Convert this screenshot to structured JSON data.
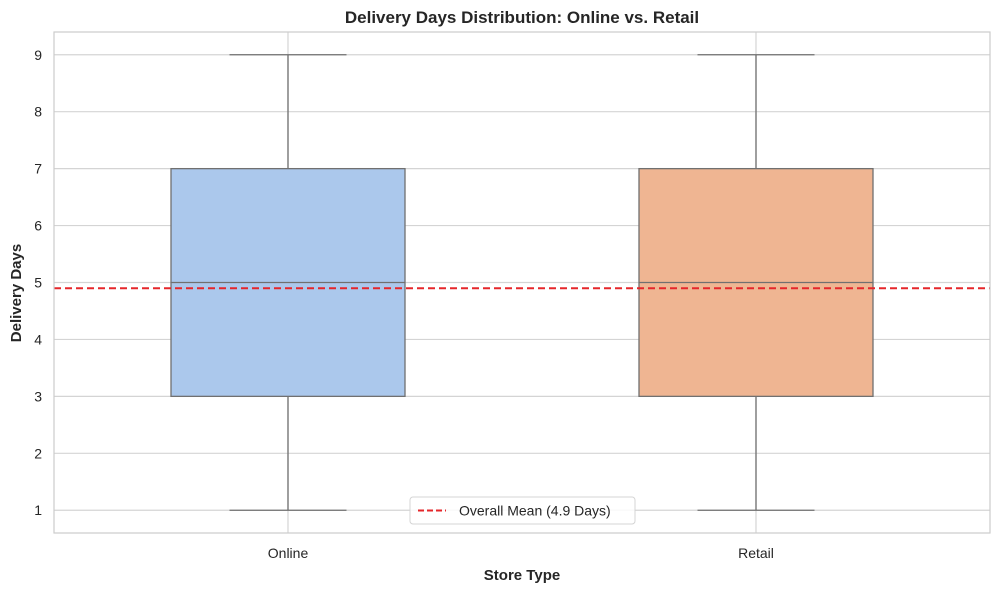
{
  "chart_data": {
    "type": "box",
    "title": "Delivery Days Distribution: Online vs. Retail",
    "xlabel": "Store Type",
    "ylabel": "Delivery Days",
    "ylim": [
      0.6,
      9.4
    ],
    "yticks": [
      1,
      2,
      3,
      4,
      5,
      6,
      7,
      8,
      9
    ],
    "categories": [
      "Online",
      "Retail"
    ],
    "boxes": [
      {
        "category": "Online",
        "min": 1,
        "q1": 3,
        "median": 5,
        "q3": 7,
        "max": 9,
        "color": "#abc8ec"
      },
      {
        "category": "Retail",
        "min": 1,
        "q1": 3,
        "median": 5,
        "q3": 7,
        "max": 9,
        "color": "#efb592"
      }
    ],
    "reference_line": {
      "value": 4.9,
      "label": "Overall Mean (4.9 Days)",
      "color": "#e5262a",
      "style": "dashed"
    },
    "grid": true,
    "legend_position": "bottom-center"
  }
}
